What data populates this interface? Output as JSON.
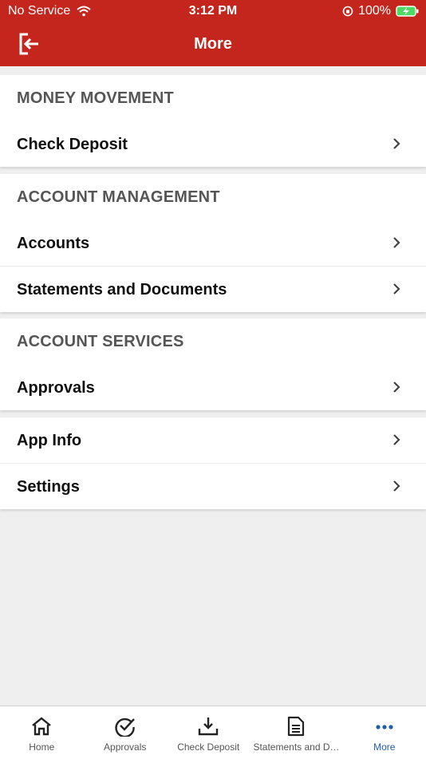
{
  "status_bar": {
    "carrier": "No Service",
    "time": "3:12 PM",
    "battery": "100%"
  },
  "header": {
    "title": "More",
    "logout_icon": "logout-icon"
  },
  "sections": [
    {
      "header": "MONEY MOVEMENT",
      "items": [
        {
          "label": "Check Deposit"
        }
      ]
    },
    {
      "header": "ACCOUNT MANAGEMENT",
      "items": [
        {
          "label": "Accounts"
        },
        {
          "label": "Statements and Documents"
        }
      ]
    },
    {
      "header": "ACCOUNT SERVICES",
      "items": [
        {
          "label": "Approvals"
        }
      ]
    },
    {
      "header": "",
      "items": [
        {
          "label": "App Info"
        },
        {
          "label": "Settings"
        }
      ]
    }
  ],
  "tabbar": {
    "tabs": [
      {
        "label": "Home",
        "icon": "home-icon"
      },
      {
        "label": "Approvals",
        "icon": "check-circle-icon"
      },
      {
        "label": "Check Deposit",
        "icon": "download-icon"
      },
      {
        "label": "Statements and D…",
        "icon": "document-icon"
      },
      {
        "label": "More",
        "icon": "more-dots-icon"
      }
    ],
    "active": "More"
  },
  "colors": {
    "brand_red": "#c4261e",
    "active_tab": "#1f5ea8",
    "background": "#efefef"
  }
}
